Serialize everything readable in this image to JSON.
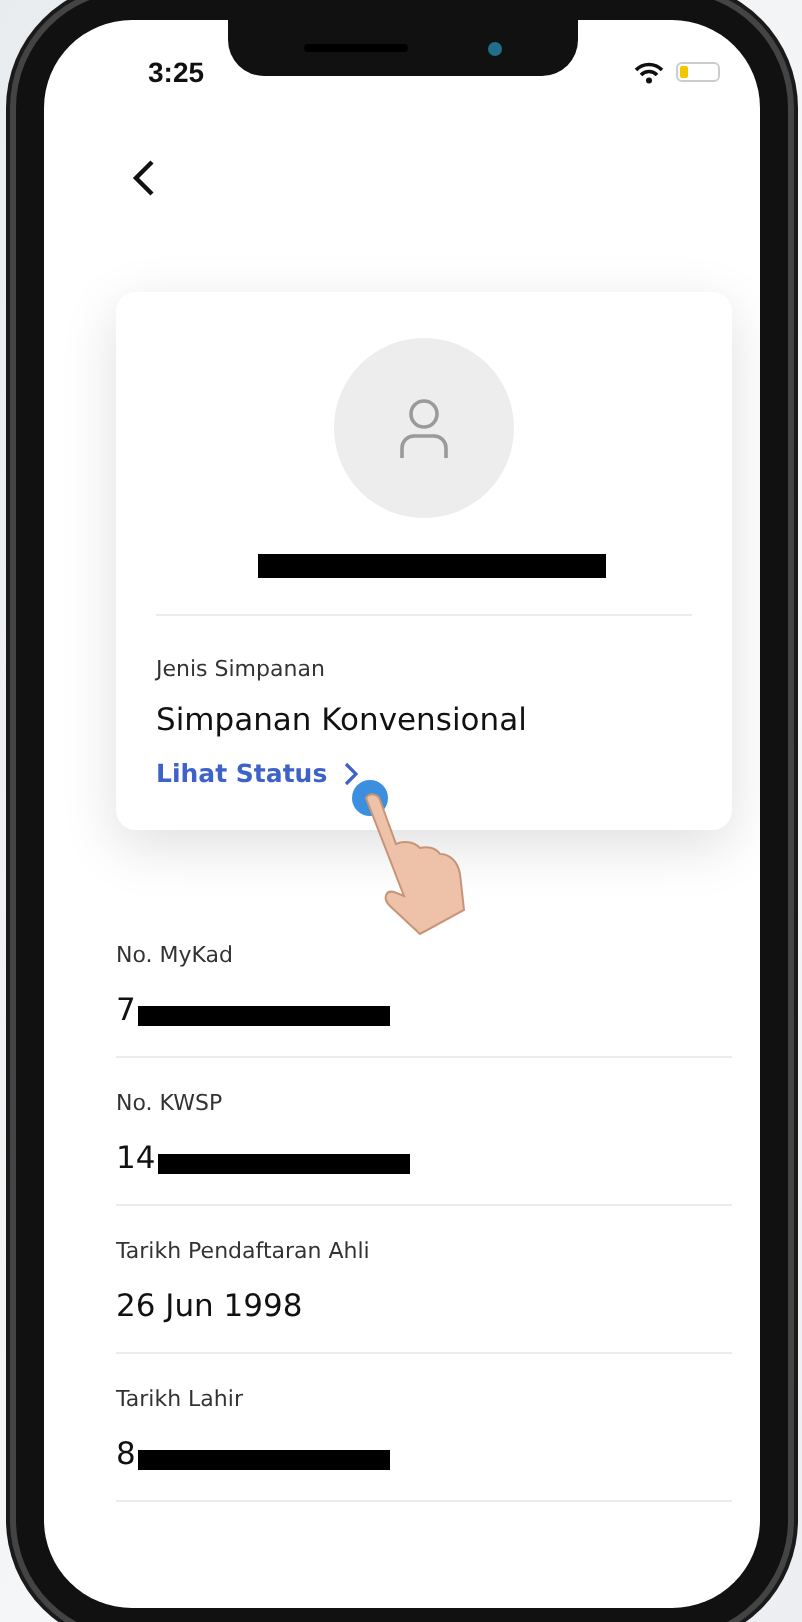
{
  "status_bar": {
    "time": "3:25"
  },
  "profile": {
    "name_redacted": true,
    "fields": [
      {
        "label": "Jenis Simpanan",
        "value": "Simpanan Konvensional"
      }
    ],
    "link": "Lihat Status"
  },
  "details": [
    {
      "label": "No. MyKad",
      "value": "7",
      "redacted": true
    },
    {
      "label": "No. KWSP",
      "value": "14",
      "redacted": true
    },
    {
      "label": "Tarikh Pendaftaran Ahli",
      "value": "26 Jun 1998",
      "redacted": false
    },
    {
      "label": "Tarikh Lahir",
      "value": "8",
      "redacted": true
    }
  ]
}
